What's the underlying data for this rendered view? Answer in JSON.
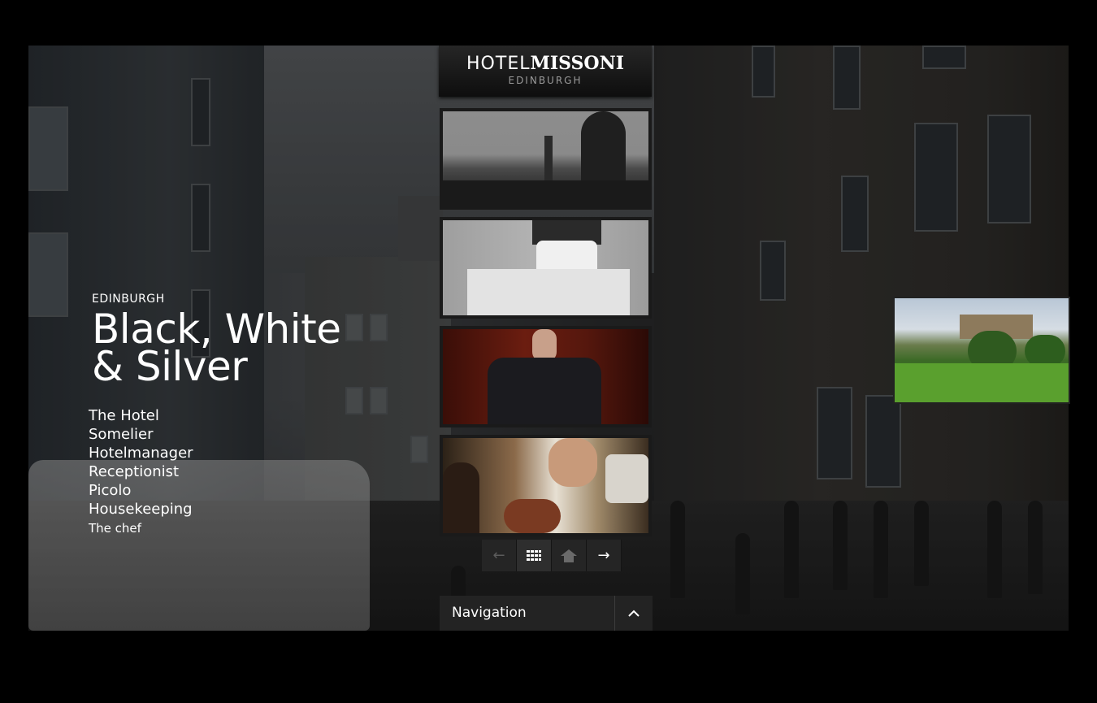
{
  "brand": {
    "name_light": "HOTEL",
    "name_bold": "MISSONI",
    "location": "EDINBURGH"
  },
  "intro": {
    "city": "EDINBURGH",
    "title_line1": "Black, White",
    "title_line2": "& Silver"
  },
  "menu": {
    "items": [
      "The Hotel",
      "Somelier",
      "Hotelmanager",
      "Receptionist",
      "Picolo",
      "Housekeeping",
      "The chef"
    ]
  },
  "thumbnails": [
    {
      "icon": "city-skyline-photo"
    },
    {
      "icon": "housekeeping-photo"
    },
    {
      "icon": "hotelmanager-photo"
    },
    {
      "icon": "chef-photo"
    }
  ],
  "controls": {
    "prev": "←",
    "grid": "grid-icon",
    "home": "home-icon",
    "next": "→"
  },
  "navigation": {
    "label": "Navigation",
    "toggle": "chevron-up-icon"
  },
  "colors": {
    "page_background": "#000000",
    "panel": "#232323",
    "text": "#ffffff"
  }
}
